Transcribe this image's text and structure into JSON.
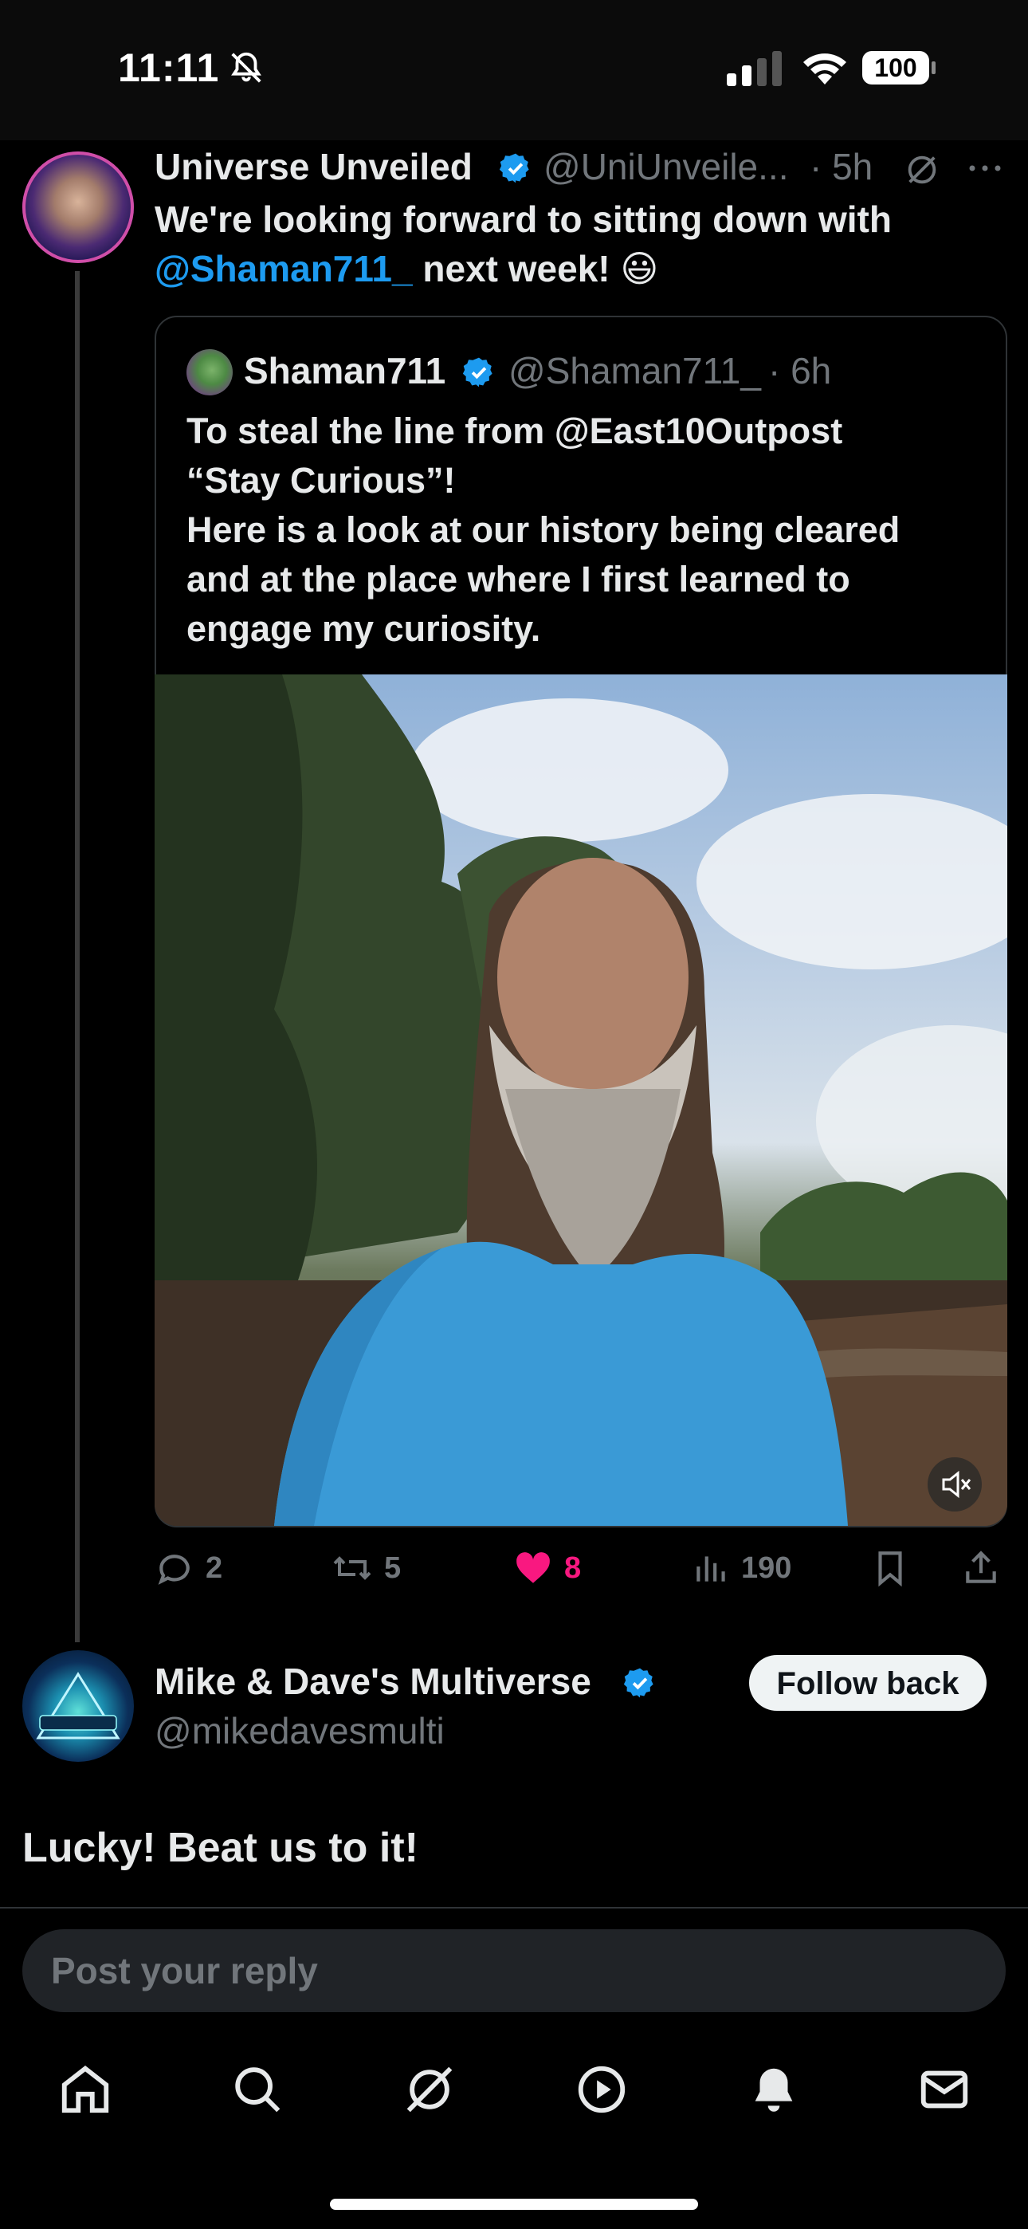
{
  "status_bar": {
    "time": "11:11",
    "battery": "100"
  },
  "tweet": {
    "display_name": "Universe Unveiled",
    "handle": "@UniUnveile...",
    "time": "· 5h",
    "text_line1": "We're looking forward to sitting down with",
    "mention": "@Shaman711_",
    "text_tail": " next week! 😃"
  },
  "quote": {
    "display_name": "Shaman711",
    "handle": "@Shaman711_",
    "time": "· 6h",
    "lines": [
      "To steal the line from @East10Outpost",
      "“Stay Curious”!",
      "Here is a look at our history being cleared",
      "and at the place where I first learned to",
      "engage my curiosity."
    ]
  },
  "actions": {
    "replies": "2",
    "reposts": "5",
    "likes": "8",
    "views": "190"
  },
  "reply": {
    "display_name": "Mike & Dave's Multiverse",
    "handle": "@mikedavesmulti",
    "follow_label": "Follow back",
    "text": "Lucky! Beat us to it!"
  },
  "composer": {
    "placeholder": "Post your reply"
  },
  "colors": {
    "accent": "#1d9bf0",
    "like": "#f91880",
    "background": "#000000",
    "muted": "#71767b"
  }
}
